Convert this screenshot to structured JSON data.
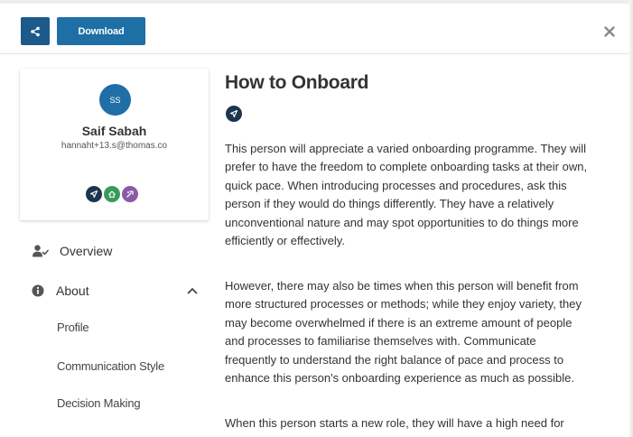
{
  "toolbar": {
    "share_icon": "share-icon",
    "download_label": "Download",
    "close_icon": "close-icon"
  },
  "profile": {
    "initials": "SS",
    "name": "Saif Sabah",
    "email": "hannaht+13.s@thomas.co",
    "badges": [
      {
        "icon": "navigate-icon",
        "color": "#1e3550"
      },
      {
        "icon": "home-icon",
        "color": "#3a9a5a"
      },
      {
        "icon": "spark-icon",
        "color": "#8a5aa8"
      }
    ]
  },
  "nav": {
    "overview_label": "Overview",
    "about_label": "About",
    "sub_items": [
      "Profile",
      "Communication Style",
      "Decision Making"
    ]
  },
  "content": {
    "title": "How to Onboard",
    "badge_icon": "navigate-icon",
    "paragraphs": [
      [
        "This person will appreciate a varied onboarding programme. They will",
        "prefer to have the freedom to complete onboarding tasks at their own,",
        "quick pace. When introducing processes and procedures, ask this",
        "person if they would do things differently. They have a relatively",
        "unconventional nature and may spot opportunities to do things more",
        "efficiently or effectively."
      ],
      [
        "However, there may also be times when this person will benefit from",
        "more structured processes or methods; while they enjoy variety, they",
        "may become overwhelmed if there is an extreme amount of people",
        "and processes to familiarise themselves with. Communicate",
        "frequently to understand the right balance of pace and process to",
        "enhance this person's onboarding experience as much as possible."
      ],
      [
        "When this person starts a new role, they will have a high need for"
      ]
    ]
  },
  "colors": {
    "primary": "#1d6fa5",
    "primary_dark": "#1d5a8c",
    "avatar": "#1f6ea6",
    "text": "#333333"
  }
}
